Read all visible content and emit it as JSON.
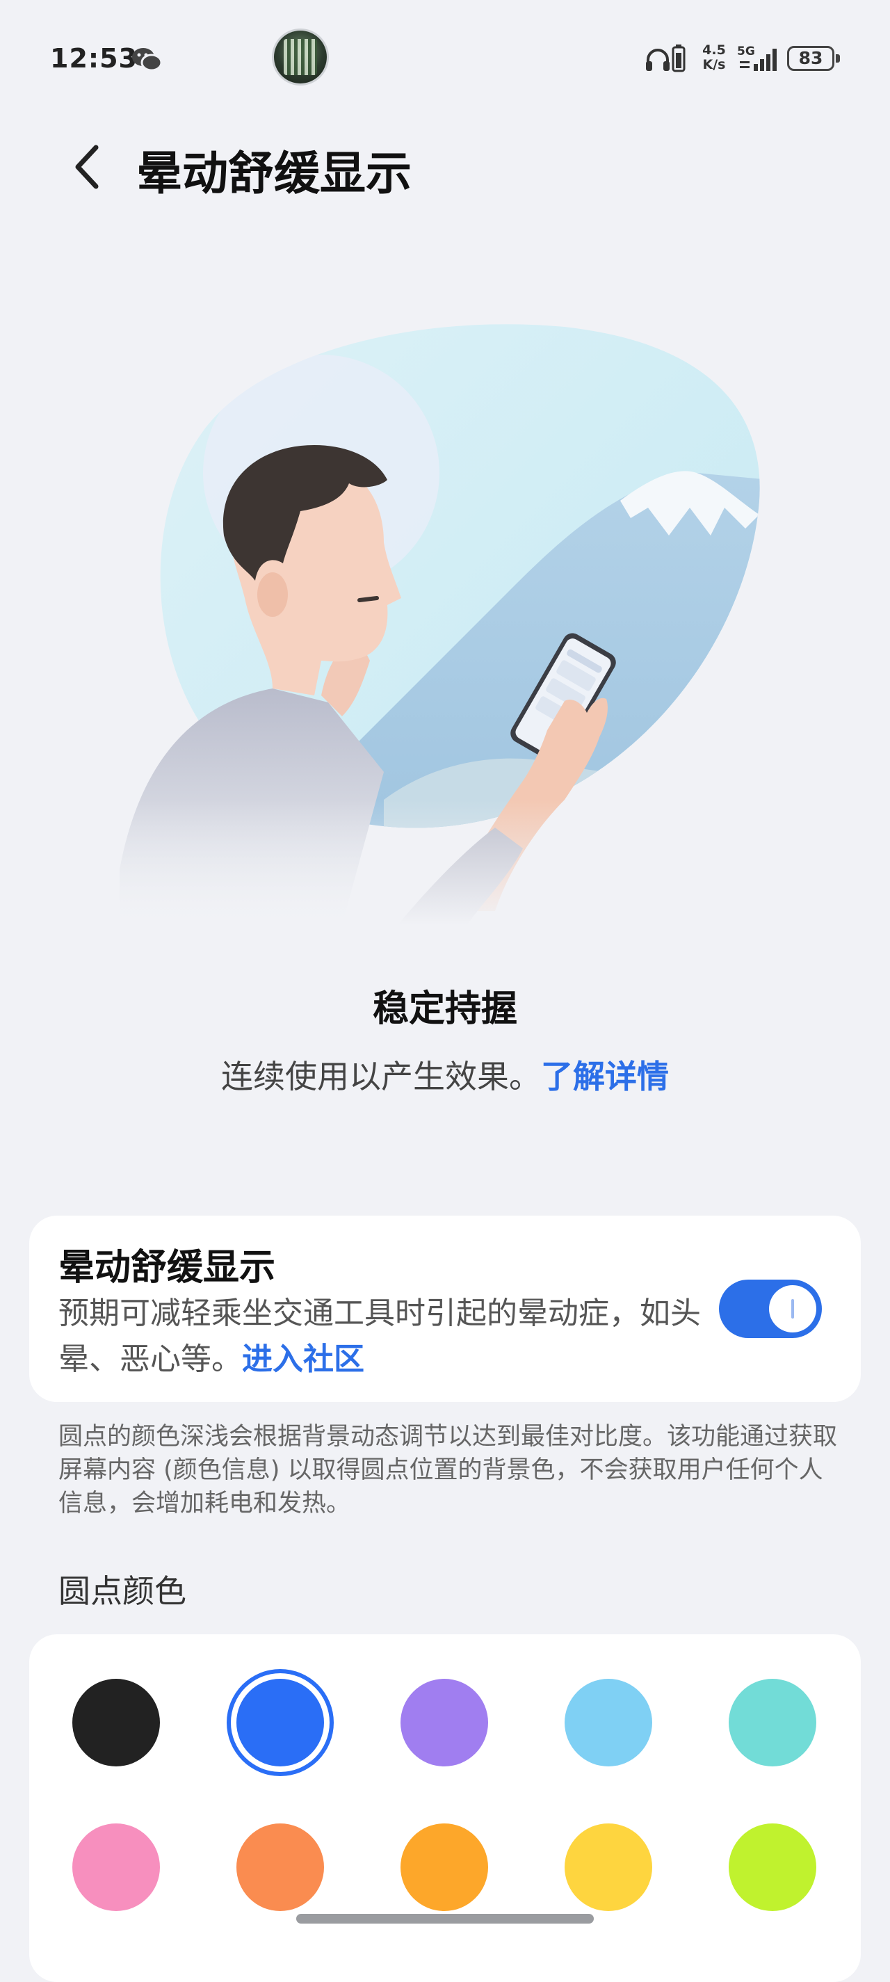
{
  "status_bar": {
    "time": "12:53",
    "net_speed_value": "4.5",
    "net_speed_unit": "K/s",
    "network_type": "5G",
    "battery_level": "83",
    "icons": [
      "wechat-icon",
      "headphone-icon",
      "battery-small-icon",
      "signal-icon",
      "battery-icon"
    ]
  },
  "header": {
    "back_icon": "chevron-left-icon",
    "title": "晕动舒缓显示"
  },
  "hint": {
    "title": "稳定持握",
    "description": "连续使用以产生效果。",
    "link": "了解详情"
  },
  "feature": {
    "title": "晕动舒缓显示",
    "description": "预期可减轻乘坐交通工具时引起的晕动症，如头晕、恶心等。",
    "link": "进入社区",
    "enabled": true
  },
  "note": "圆点的颜色深浅会根据背景动态调节以达到最佳对比度。该功能通过获取屏幕内容 (颜色信息) 以取得圆点位置的背景色，不会获取用户任何个人信息，会增加耗电和发热。",
  "dot_color": {
    "section_title": "圆点颜色",
    "selected": "#2a6ef6",
    "colors": [
      "#222222",
      "#2a6ef6",
      "#a07ef0",
      "#7fd0f4",
      "#72dcd7",
      "#f78fbe",
      "#fa8c50",
      "#fda72a",
      "#fed53f",
      "#c0f22e"
    ]
  },
  "theme": {
    "accent": "#2c6fe8",
    "background": "#f1f2f6"
  }
}
